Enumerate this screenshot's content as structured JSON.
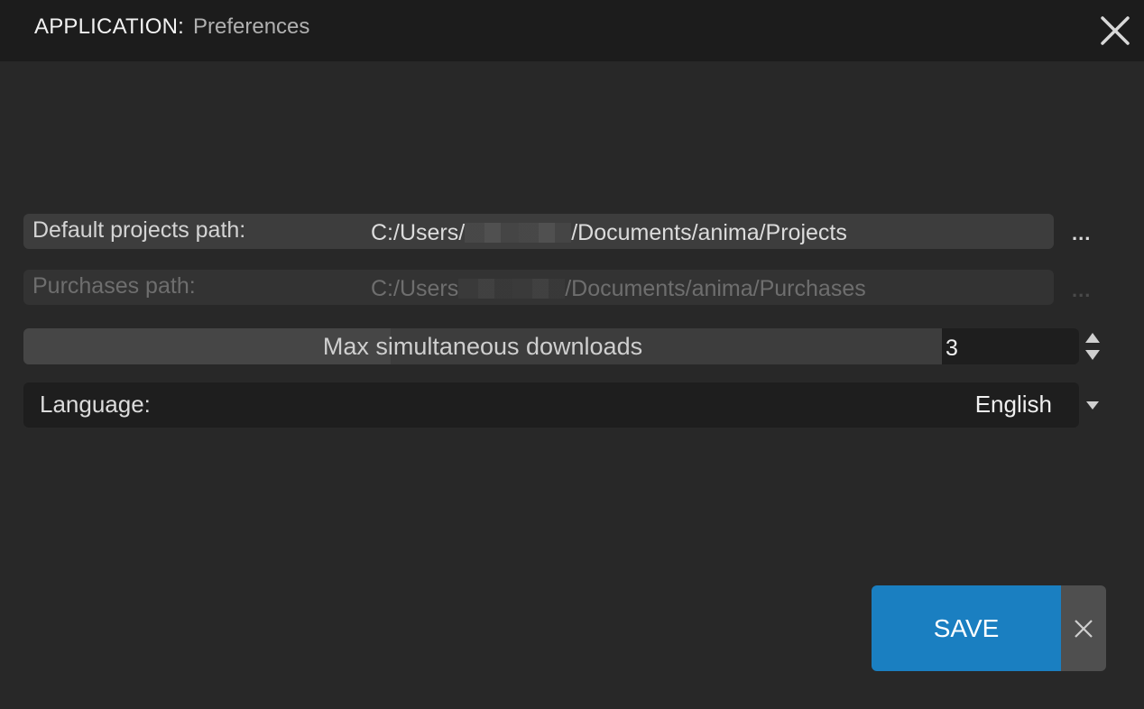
{
  "title": {
    "app_label": "APPLICATION:",
    "page_name": "Preferences",
    "close_icon": "close-icon"
  },
  "settings": {
    "default_projects": {
      "label": "Default projects path:",
      "value_prefix": "C:/Users/",
      "value_suffix": "/Documents/anima/Projects",
      "browse_label": "...",
      "enabled": true
    },
    "purchases": {
      "label": "Purchases path:",
      "value_prefix": "C:/Users",
      "value_suffix": "/Documents/anima/Purchases",
      "browse_label": "...",
      "enabled": false
    },
    "max_downloads": {
      "label": "Max simultaneous downloads",
      "value": "3",
      "fill_fraction": 0.4
    },
    "language": {
      "label": "Language:",
      "value": "English"
    }
  },
  "actions": {
    "save_label": "SAVE",
    "cancel_icon": "close-icon"
  },
  "colors": {
    "accent": "#1a7fc1",
    "background": "#282828",
    "titlebar": "#1c1c1c"
  }
}
